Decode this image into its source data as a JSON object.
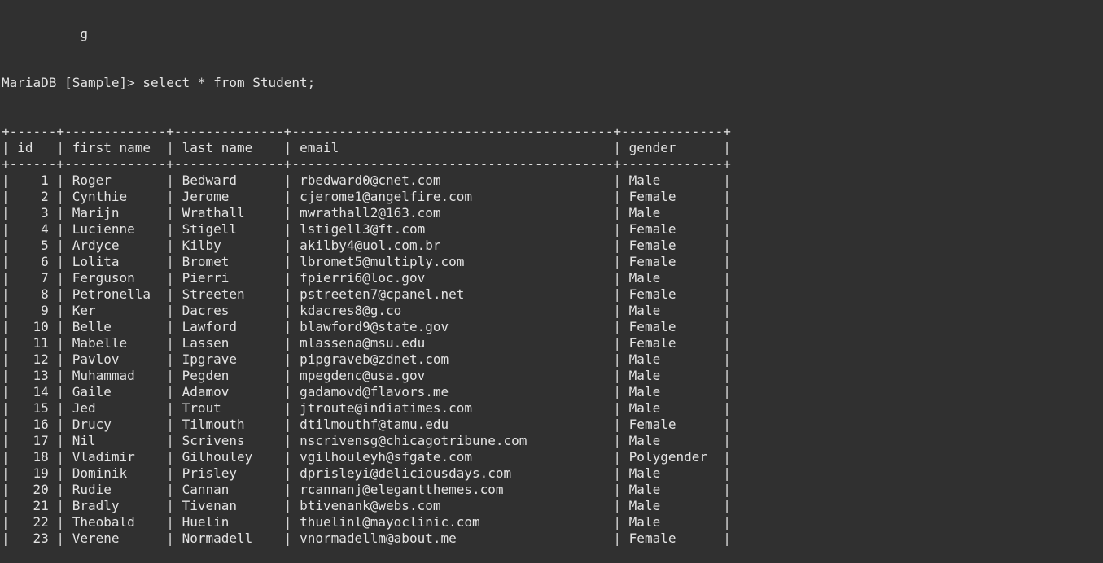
{
  "terminal": {
    "partial_previous_line": "          g",
    "prompt": "MariaDB [Sample]> ",
    "command": "select * from Student;"
  },
  "table": {
    "columns": [
      "id",
      "first_name",
      "last_name",
      "email",
      "gender"
    ],
    "widths": [
      4,
      11,
      12,
      39,
      11
    ],
    "rows": [
      [
        "1",
        "Roger",
        "Bedward",
        "rbedward0@cnet.com",
        "Male"
      ],
      [
        "2",
        "Cynthie",
        "Jerome",
        "cjerome1@angelfire.com",
        "Female"
      ],
      [
        "3",
        "Marijn",
        "Wrathall",
        "mwrathall2@163.com",
        "Male"
      ],
      [
        "4",
        "Lucienne",
        "Stigell",
        "lstigell3@ft.com",
        "Female"
      ],
      [
        "5",
        "Ardyce",
        "Kilby",
        "akilby4@uol.com.br",
        "Female"
      ],
      [
        "6",
        "Lolita",
        "Bromet",
        "lbromet5@multiply.com",
        "Female"
      ],
      [
        "7",
        "Ferguson",
        "Pierri",
        "fpierri6@loc.gov",
        "Male"
      ],
      [
        "8",
        "Petronella",
        "Streeten",
        "pstreeten7@cpanel.net",
        "Female"
      ],
      [
        "9",
        "Ker",
        "Dacres",
        "kdacres8@g.co",
        "Male"
      ],
      [
        "10",
        "Belle",
        "Lawford",
        "blawford9@state.gov",
        "Female"
      ],
      [
        "11",
        "Mabelle",
        "Lassen",
        "mlassena@msu.edu",
        "Female"
      ],
      [
        "12",
        "Pavlov",
        "Ipgrave",
        "pipgraveb@zdnet.com",
        "Male"
      ],
      [
        "13",
        "Muhammad",
        "Pegden",
        "mpegdenc@usa.gov",
        "Male"
      ],
      [
        "14",
        "Gaile",
        "Adamov",
        "gadamovd@flavors.me",
        "Male"
      ],
      [
        "15",
        "Jed",
        "Trout",
        "jtroute@indiatimes.com",
        "Male"
      ],
      [
        "16",
        "Drucy",
        "Tilmouth",
        "dtilmouthf@tamu.edu",
        "Female"
      ],
      [
        "17",
        "Nil",
        "Scrivens",
        "nscrivensg@chicagotribune.com",
        "Male"
      ],
      [
        "18",
        "Vladimir",
        "Gilhouley",
        "vgilhouleyh@sfgate.com",
        "Polygender"
      ],
      [
        "19",
        "Dominik",
        "Prisley",
        "dprisleyi@deliciousdays.com",
        "Male"
      ],
      [
        "20",
        "Rudie",
        "Cannan",
        "rcannanj@elegantthemes.com",
        "Male"
      ],
      [
        "21",
        "Bradly",
        "Tivenan",
        "btivenank@webs.com",
        "Male"
      ],
      [
        "22",
        "Theobald",
        "Huelin",
        "thuelinl@mayoclinic.com",
        "Male"
      ],
      [
        "23",
        "Verene",
        "Normadell",
        "vnormadellm@about.me",
        "Female"
      ]
    ]
  },
  "colors": {
    "background": "#303030",
    "foreground": "#e3e3e3"
  }
}
